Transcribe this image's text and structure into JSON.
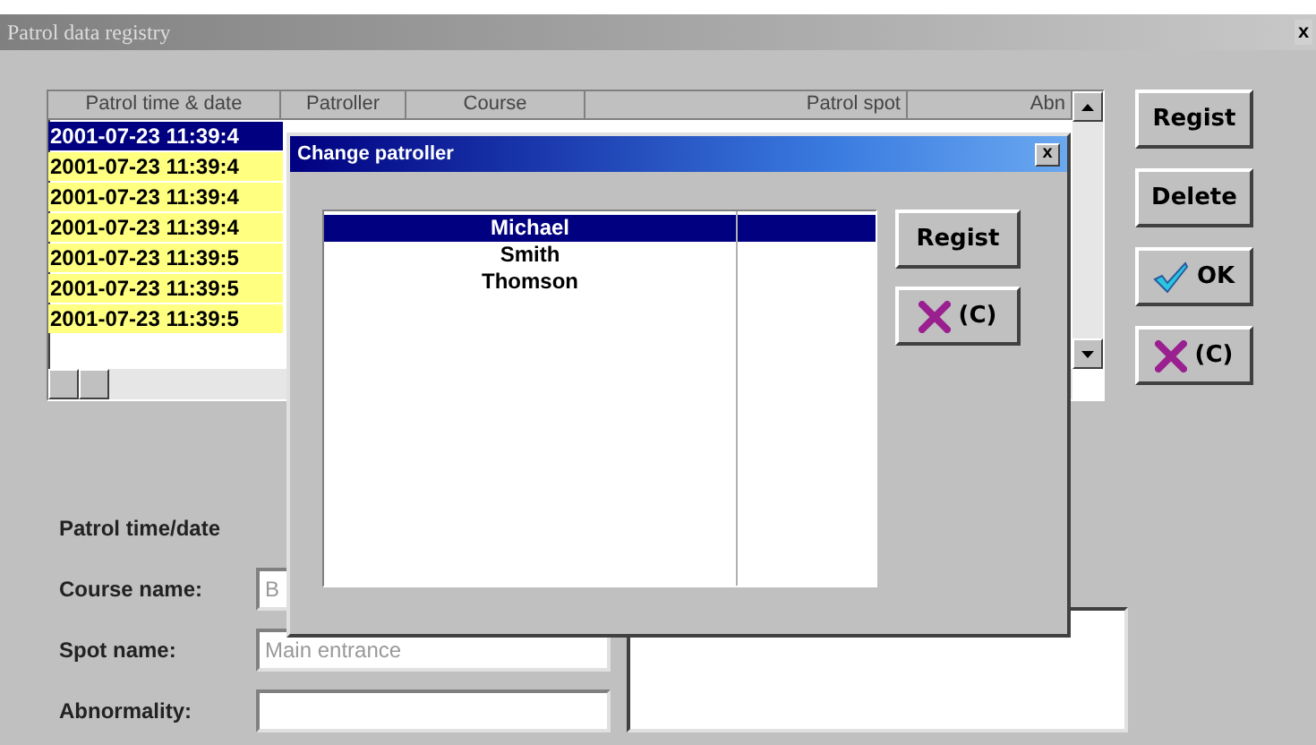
{
  "window": {
    "title": "Patrol data registry",
    "close": "x"
  },
  "table": {
    "columns": [
      "Patrol time & date",
      "Patroller",
      "Course",
      "Patrol spot",
      "Abn"
    ],
    "rows": [
      {
        "time": "2001-07-23 11:39:4",
        "selected": true
      },
      {
        "time": "2001-07-23 11:39:4",
        "selected": false
      },
      {
        "time": "2001-07-23 11:39:4",
        "selected": false
      },
      {
        "time": "2001-07-23 11:39:4",
        "selected": false
      },
      {
        "time": "2001-07-23 11:39:5",
        "selected": false
      },
      {
        "time": "2001-07-23 11:39:5",
        "selected": false
      },
      {
        "time": "2001-07-23 11:39:5",
        "selected": false
      }
    ]
  },
  "buttons": [
    {
      "kind": "text",
      "label": "Regist"
    },
    {
      "kind": "text",
      "label": "Delete"
    },
    {
      "kind": "ok",
      "label": "OK"
    },
    {
      "kind": "cancel",
      "label": "(C)"
    }
  ],
  "form": [
    {
      "label": "Patrol time/date",
      "kind": "none"
    },
    {
      "label": "Course name:",
      "kind": "field",
      "value": "B"
    },
    {
      "label": "Spot name:",
      "kind": "field",
      "value": "Main entrance"
    },
    {
      "label": "Abnormality:",
      "kind": "field"
    }
  ],
  "dialog": {
    "title": "Change patroller",
    "close": "x",
    "patrollers": [
      {
        "name": "Michael",
        "selected": true
      },
      {
        "name": "Smith",
        "selected": false
      },
      {
        "name": "Thomson",
        "selected": false
      }
    ],
    "buttons": [
      {
        "kind": "text",
        "label": "Regist"
      },
      {
        "kind": "cancel",
        "label": "(C)"
      }
    ]
  }
}
